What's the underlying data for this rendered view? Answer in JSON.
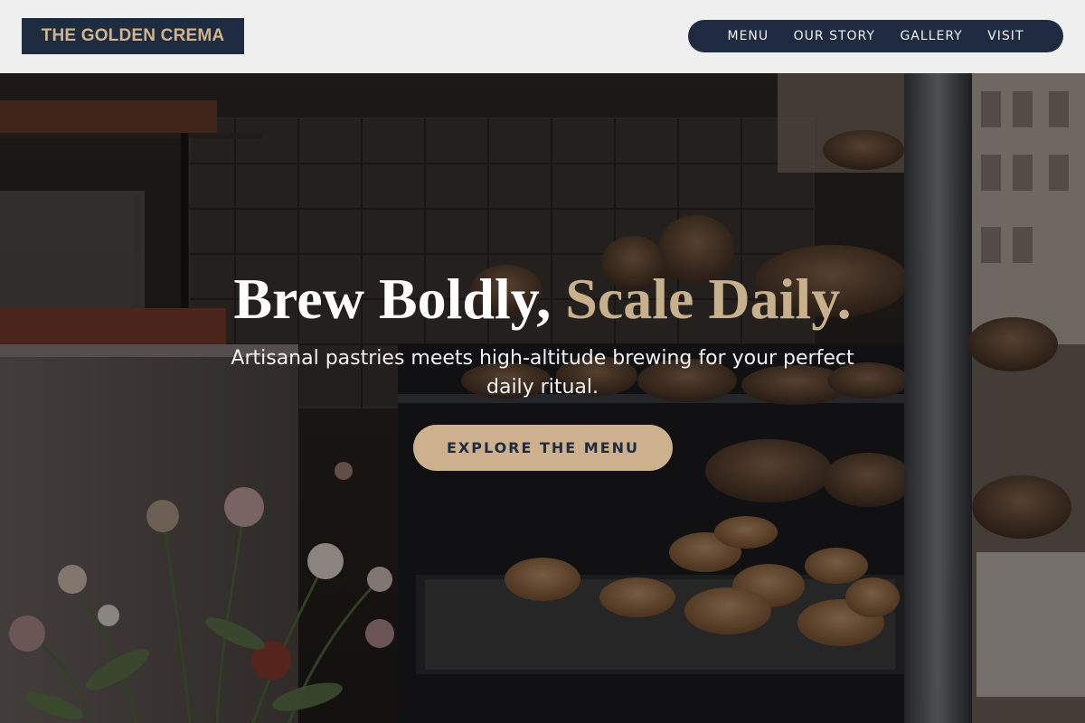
{
  "brand": {
    "name": "THE GOLDEN CREMA"
  },
  "nav": {
    "items": [
      {
        "label": "MENU"
      },
      {
        "label": "OUR STORY"
      },
      {
        "label": "GALLERY"
      },
      {
        "label": "VISIT"
      }
    ]
  },
  "hero": {
    "title_main": "Brew Boldly,",
    "title_accent": "Scale Daily.",
    "subtitle": "Artisanal pastries meets high-altitude brewing for your perfect daily ritual.",
    "cta_label": "EXPLORE THE MENU",
    "background_description_icon": "bakery-display-photo"
  },
  "colors": {
    "navy": "#1f2b40",
    "gold": "#cdb08e",
    "header_bg": "#efefef"
  }
}
